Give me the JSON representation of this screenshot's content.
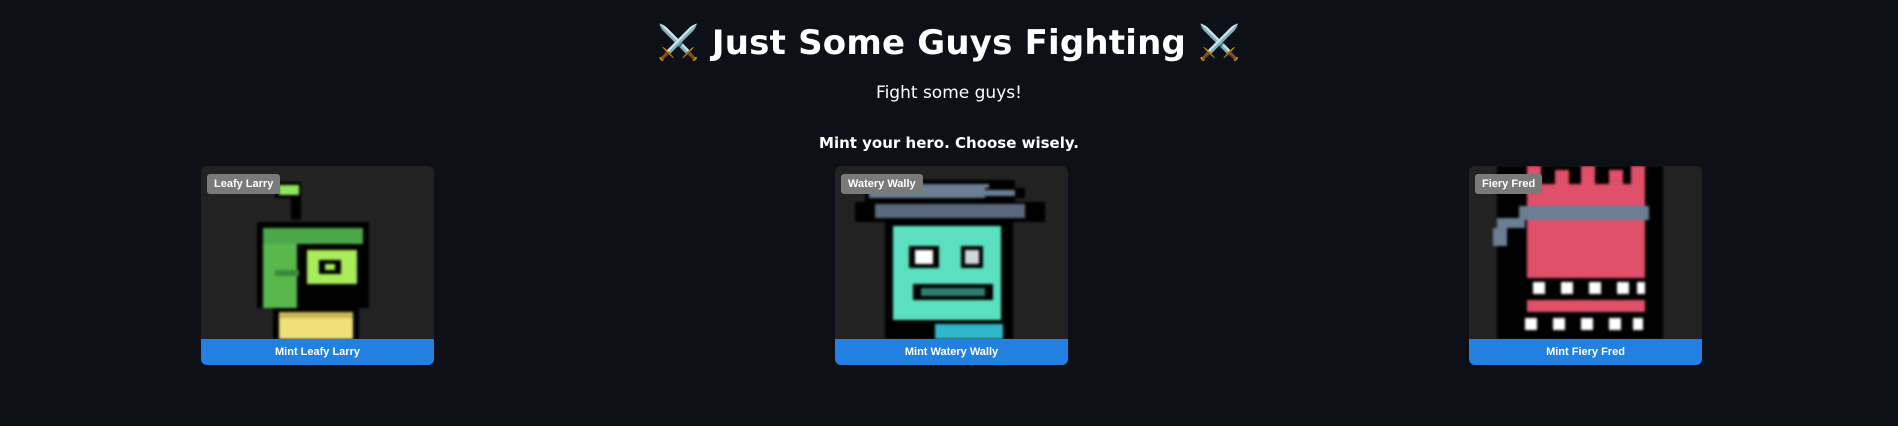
{
  "header": {
    "title_icon": "⚔️",
    "title": "Just Some Guys Fighting",
    "subtitle": "Fight some guys!"
  },
  "mint_prompt": "Mint your hero. Choose wisely.",
  "heroes": [
    {
      "name": "Leafy Larry",
      "button_label": "Mint Leafy Larry",
      "icon": "green-plant-character-icon",
      "accent_color": "#8fe65a"
    },
    {
      "name": "Watery Wally",
      "button_label": "Mint Watery Wally",
      "icon": "teal-wizard-character-icon",
      "accent_color": "#5ae0c0"
    },
    {
      "name": "Fiery Fred",
      "button_label": "Mint Fiery Fred",
      "icon": "red-monster-character-icon",
      "accent_color": "#e0506a"
    }
  ],
  "colors": {
    "background": "#0d1117",
    "card_background": "#222222",
    "button": "#2280e0",
    "tag": "#7a7a7a"
  }
}
